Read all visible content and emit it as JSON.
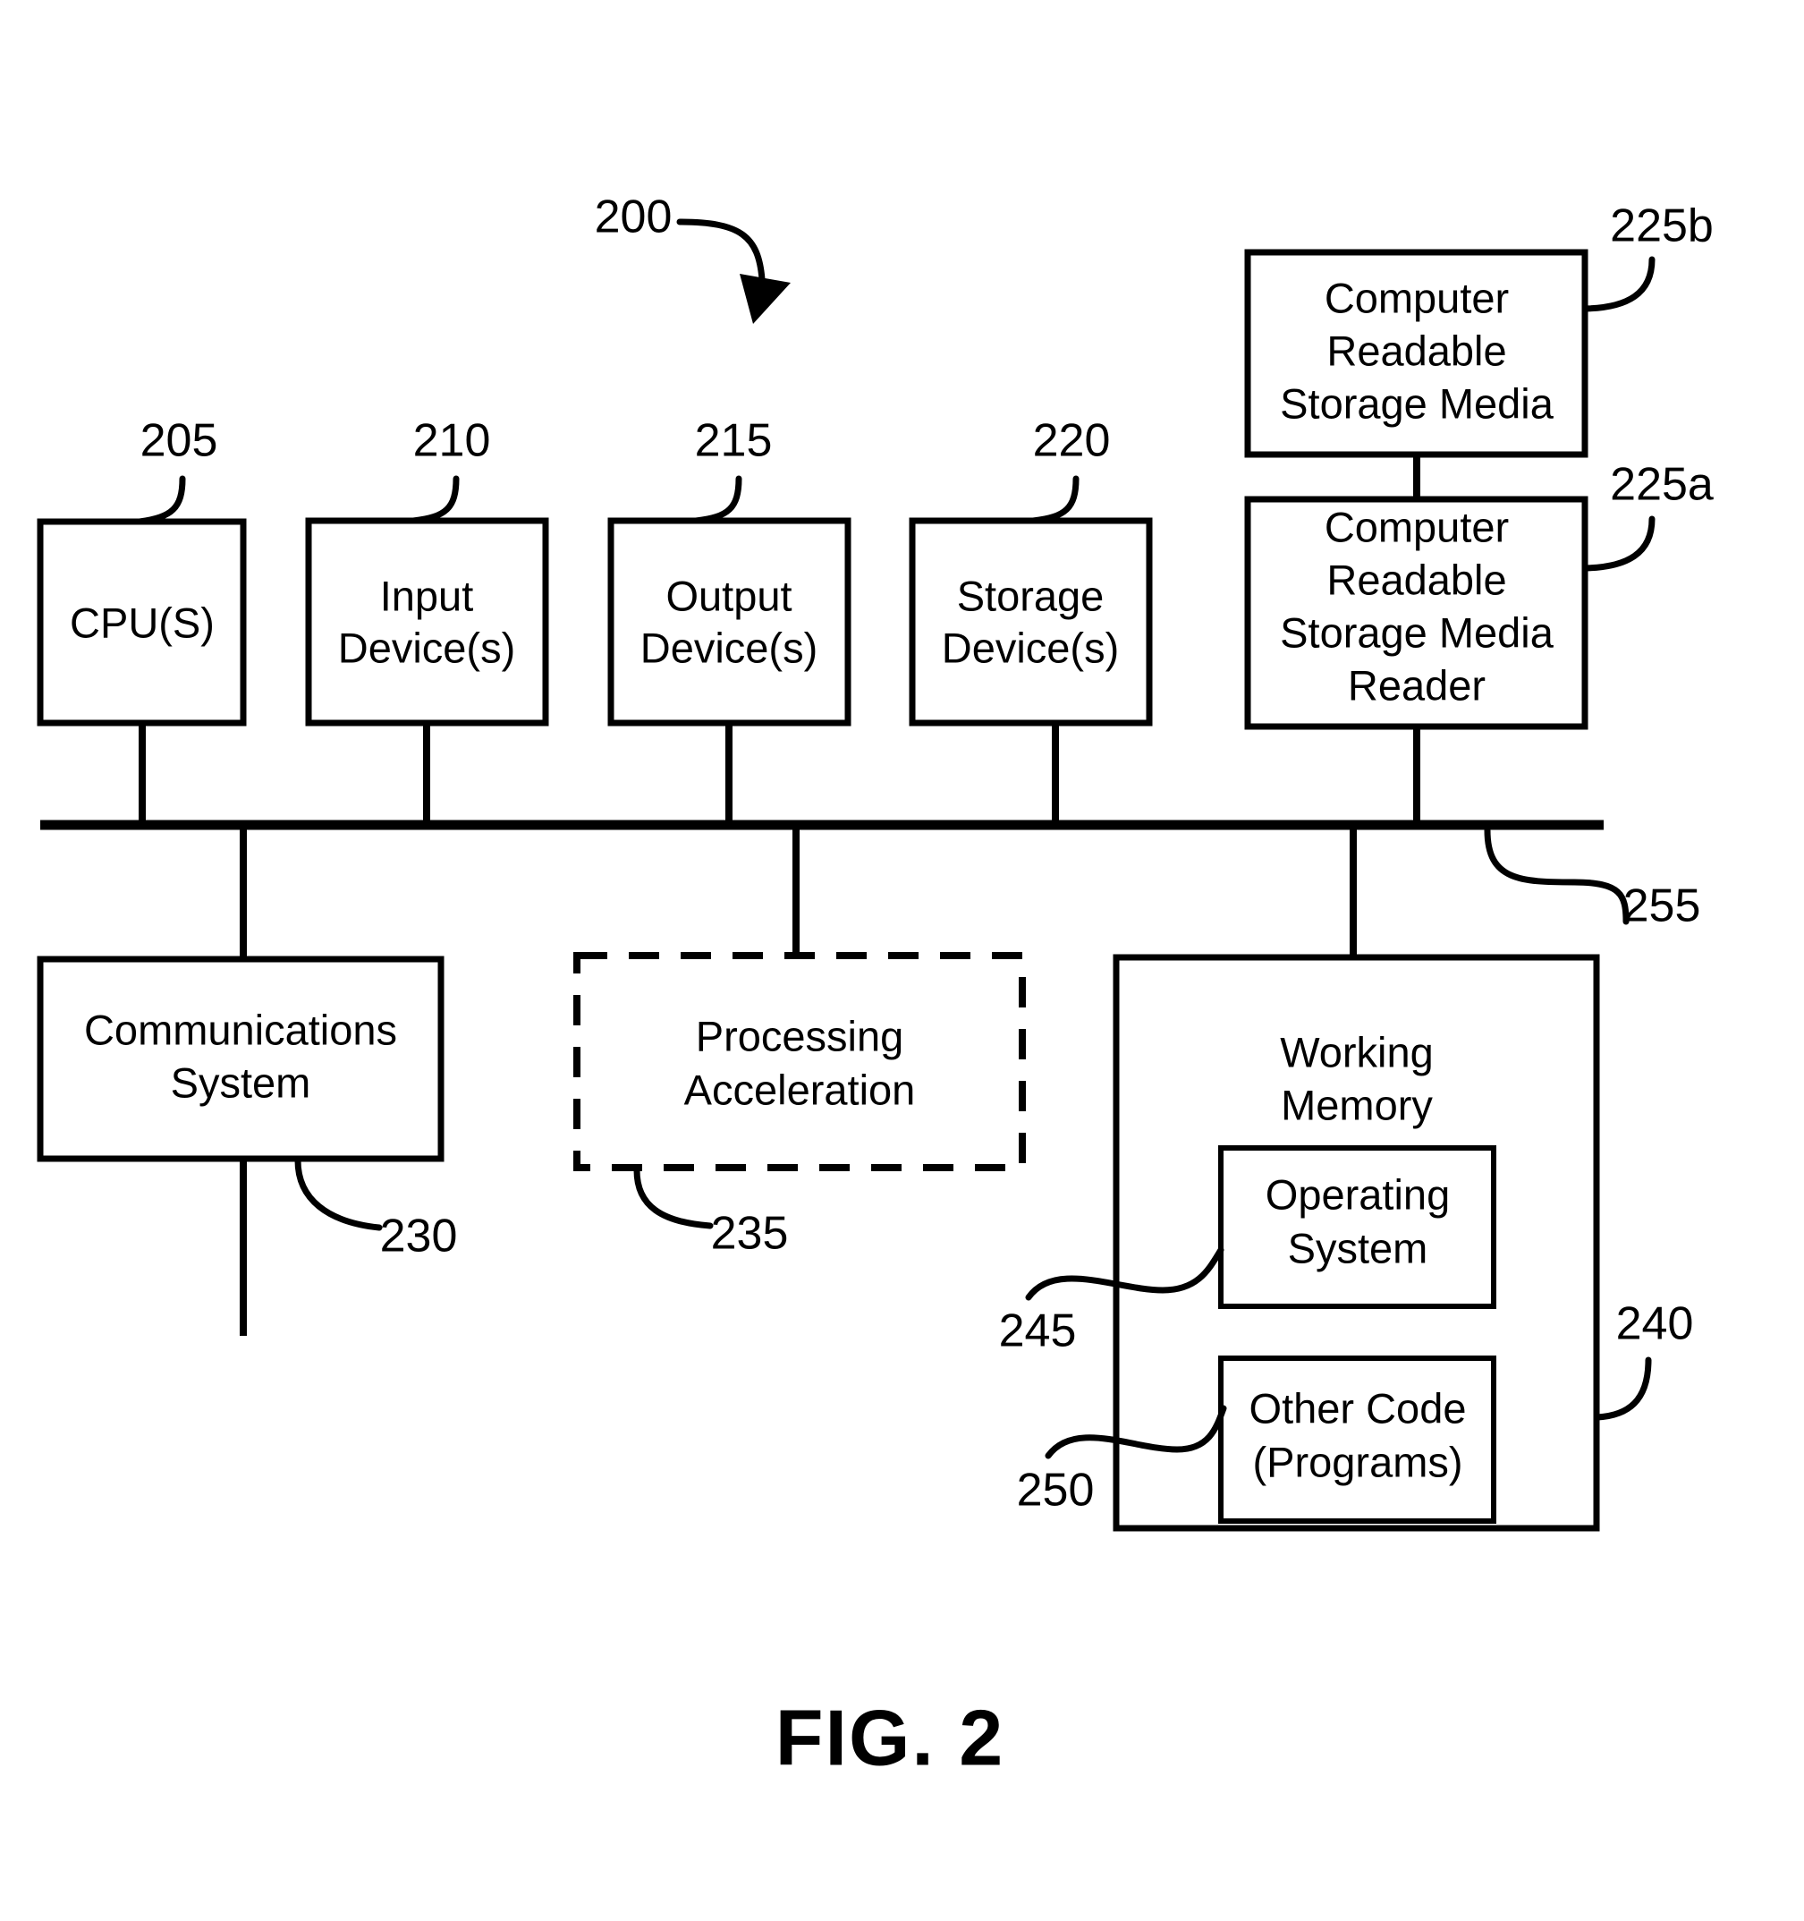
{
  "figure": {
    "caption": "FIG. 2",
    "system_ref": "200"
  },
  "blocks": [
    {
      "id": "cpu",
      "lines": [
        "CPU(S)"
      ],
      "ref": "205",
      "style": "solid"
    },
    {
      "id": "input-devices",
      "lines": [
        "Input",
        "Device(s)"
      ],
      "ref": "210",
      "style": "solid"
    },
    {
      "id": "output-devices",
      "lines": [
        "Output",
        "Device(s)"
      ],
      "ref": "215",
      "style": "solid"
    },
    {
      "id": "storage-devices",
      "lines": [
        "Storage",
        "Device(s)"
      ],
      "ref": "220",
      "style": "solid"
    },
    {
      "id": "computer-readable-storage-media",
      "lines": [
        "Computer",
        "Readable",
        "Storage Media"
      ],
      "ref": "225b",
      "style": "solid"
    },
    {
      "id": "computer-readable-storage-media-reader",
      "lines": [
        "Computer",
        "Readable",
        "Storage Media",
        "Reader"
      ],
      "ref": "225a",
      "style": "solid"
    },
    {
      "id": "communications-system",
      "lines": [
        "Communications",
        "System"
      ],
      "ref": "230",
      "style": "solid"
    },
    {
      "id": "processing-acceleration",
      "lines": [
        "Processing",
        "Acceleration"
      ],
      "ref": "235",
      "style": "dashed"
    },
    {
      "id": "working-memory",
      "lines": [
        "Working",
        "Memory"
      ],
      "ref": "240",
      "style": "solid"
    },
    {
      "id": "operating-system",
      "lines": [
        "Operating",
        "System"
      ],
      "ref": "245",
      "style": "solid"
    },
    {
      "id": "other-code-programs",
      "lines": [
        "Other Code",
        "(Programs)"
      ],
      "ref": "250",
      "style": "solid"
    }
  ],
  "bus": {
    "ref": "255"
  },
  "labels": {
    "cpu_l1": "CPU(S)",
    "input_l1": "Input",
    "input_l2": "Device(s)",
    "output_l1": "Output",
    "output_l2": "Device(s)",
    "storage_l1": "Storage",
    "storage_l2": "Device(s)",
    "crsm_l1": "Computer",
    "crsm_l2": "Readable",
    "crsm_l3": "Storage Media",
    "crsmr_l1": "Computer",
    "crsmr_l2": "Readable",
    "crsmr_l3": "Storage Media",
    "crsmr_l4": "Reader",
    "comm_l1": "Communications",
    "comm_l2": "System",
    "proc_l1": "Processing",
    "proc_l2": "Acceleration",
    "wm_l1": "Working",
    "wm_l2": "Memory",
    "os_l1": "Operating",
    "os_l2": "System",
    "oc_l1": "Other Code",
    "oc_l2": "(Programs)"
  },
  "refs": {
    "r200": "200",
    "r205": "205",
    "r210": "210",
    "r215": "215",
    "r220": "220",
    "r225a": "225a",
    "r225b": "225b",
    "r230": "230",
    "r235": "235",
    "r240": "240",
    "r245": "245",
    "r250": "250",
    "r255": "255"
  },
  "colors": {
    "ink": "#000000",
    "paper": "#ffffff"
  }
}
